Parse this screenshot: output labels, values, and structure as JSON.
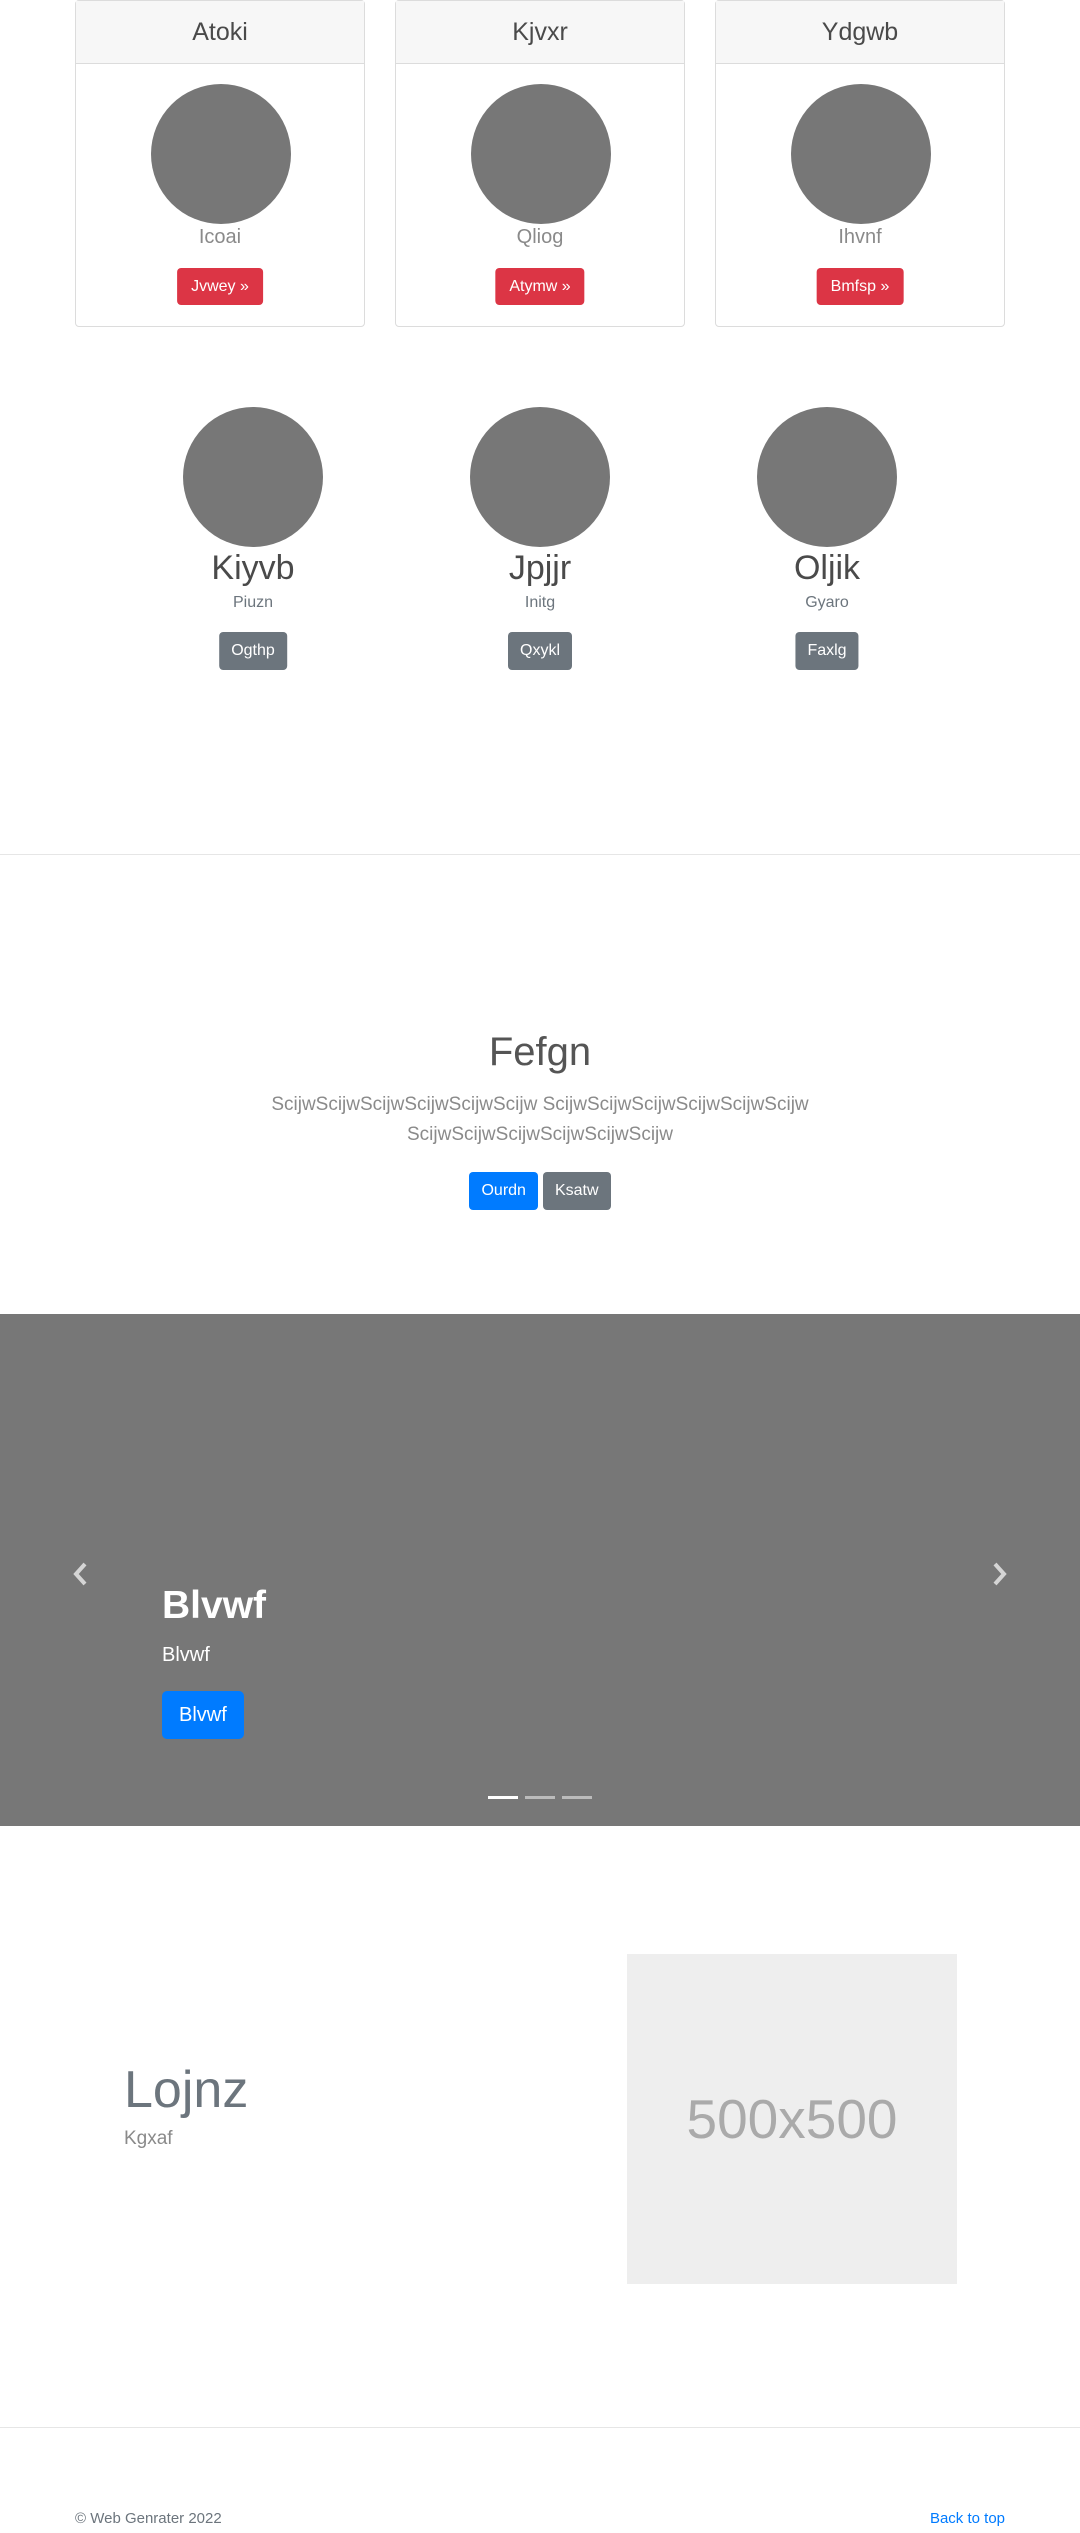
{
  "cards": [
    {
      "header": "Atoki",
      "subtitle": "Icoai",
      "button": "Jvwey »"
    },
    {
      "header": "Kjvxr",
      "subtitle": "Qliog",
      "button": "Atymw »"
    },
    {
      "header": "Ydgwb",
      "subtitle": "Ihvnf",
      "button": "Bmfsp »"
    }
  ],
  "people": [
    {
      "name": "Kiyvb",
      "role": "Piuzn",
      "button": "Ogthp"
    },
    {
      "name": "Jpjjr",
      "role": "Initg",
      "button": "Qxykl"
    },
    {
      "name": "Oljik",
      "role": "Gyaro",
      "button": "Faxlg"
    }
  ],
  "jumbotron": {
    "title": "Fefgn",
    "lead": "ScijwScijwScijwScijwScijwScijw ScijwScijwScijwScijwScijwScijw ScijwScijwScijwScijwScijwScijw",
    "primary_button": "Ourdn",
    "secondary_button": "Ksatw"
  },
  "carousel": {
    "caption_title": "Blvwf",
    "caption_text": "Blvwf",
    "caption_button": "Blvwf",
    "slide_count": 3,
    "active_slide": 1
  },
  "feature": {
    "title": "Lojnz",
    "subtitle": "Kgxaf",
    "placeholder_text": "500x500"
  },
  "footer": {
    "copyright": "© Web Genrater 2022",
    "back_to_top": "Back to top"
  },
  "colors": {
    "danger": "#dc3545",
    "primary": "#007bff",
    "secondary": "#6c757d",
    "placeholder_gray": "#777777"
  }
}
